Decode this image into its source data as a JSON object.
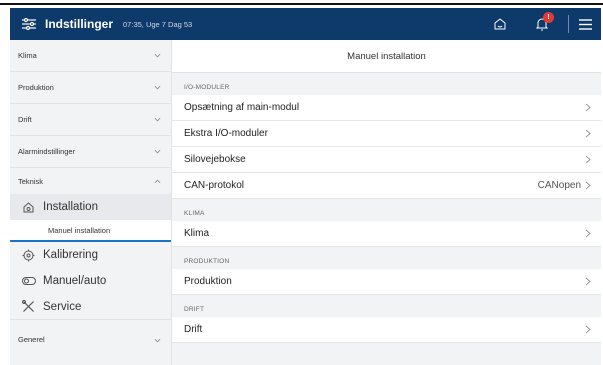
{
  "header": {
    "title": "Indstillinger",
    "subtitle": "07:35, Uge 7 Dag 53",
    "notification_count": "!",
    "icons": [
      "settings-sliders-icon",
      "home-icon",
      "bell-icon",
      "hamburger-icon"
    ]
  },
  "sidebar": {
    "categories": [
      "Klima",
      "Produktion",
      "Drift",
      "Alarmindstillinger",
      "Teknisk"
    ],
    "sub_items": [
      "Installation",
      "Kalibrering",
      "Manuel/auto",
      "Service"
    ],
    "leaf": "Manuel installation",
    "last_category": "Generel"
  },
  "main": {
    "title": "Manuel installation",
    "sections": [
      {
        "label": "I/O-MODULER",
        "rows": [
          {
            "label": "Opsætning af main-modul",
            "value": ""
          },
          {
            "label": "Ekstra I/O-moduler",
            "value": ""
          },
          {
            "label": "Silovejebokse",
            "value": ""
          },
          {
            "label": "CAN-protokol",
            "value": "CANopen"
          }
        ]
      },
      {
        "label": "KLIMA",
        "rows": [
          {
            "label": "Klima",
            "value": ""
          }
        ]
      },
      {
        "label": "PRODUKTION",
        "rows": [
          {
            "label": "Produktion",
            "value": ""
          }
        ]
      },
      {
        "label": "DRIFT",
        "rows": [
          {
            "label": "Drift",
            "value": ""
          }
        ]
      }
    ]
  },
  "colors": {
    "header_bg": "#0d3a6b",
    "accent": "#1a73c8",
    "badge": "#e53935"
  }
}
